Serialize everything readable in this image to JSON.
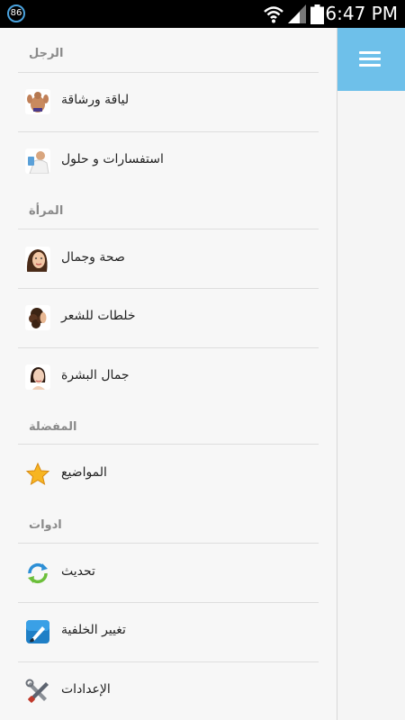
{
  "status_bar": {
    "badge": "86",
    "time": "6:47 PM",
    "icons": [
      "wifi-icon",
      "signal-icon",
      "battery-icon"
    ]
  },
  "drawer": {
    "sections": {
      "men": "الرجل",
      "women": "المرأة",
      "favorites": "المفضلة",
      "tools": "ادوات"
    },
    "items": {
      "fitness": "لياقة ورشاقة",
      "inquiries": "استفسارات و حلول",
      "health_beauty": "صحة وجمال",
      "hair_mixes": "خلطات للشعر",
      "skin_beauty": "جمال البشرة",
      "topics": "المواضيع",
      "update": "تحديث",
      "change_background": "تغيير الخلفية",
      "settings": "الإعدادات"
    }
  },
  "colors": {
    "accent": "#6ec0ea",
    "section_text": "#8a8a8a",
    "divider": "#dedede",
    "statusbar": "#000000"
  },
  "main": {
    "menu_icon": "hamburger-menu-icon"
  }
}
